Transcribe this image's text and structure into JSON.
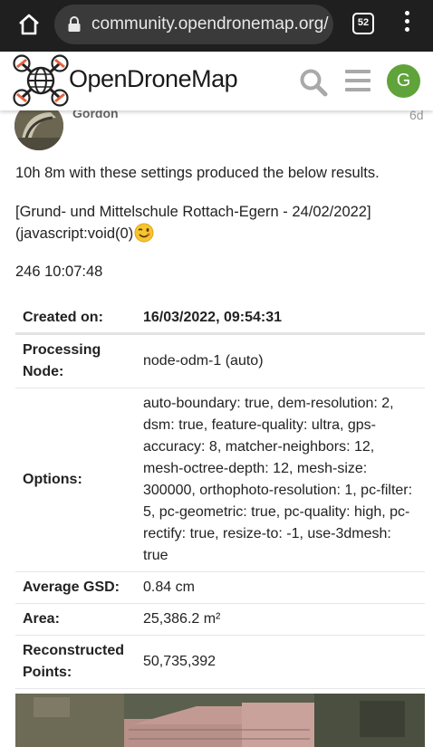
{
  "browser": {
    "url": "community.opendronemap.org/",
    "tab_count": "52"
  },
  "site": {
    "brand": "OpenDroneMap",
    "user_initial": "G"
  },
  "post": {
    "username": "Gordon",
    "age": "6d",
    "paragraph1": "10h 8m with these settings produced the below results.",
    "link_text": "[Grund- und Mittelschule Rottach-Egern - 24/02/2022]",
    "link_href_text": "(javascript:void(0)",
    "emoji": "😉",
    "task_line": "246 10:07:48"
  },
  "table": {
    "header": {
      "key": "Created on:",
      "value": "16/03/2022, 09:54:31"
    },
    "rows": [
      {
        "key": "Processing Node:",
        "value": "node-odm-1 (auto)"
      },
      {
        "key": "Options:",
        "value": "auto-boundary: true, dem-resolution: 2, dsm: true, feature-quality: ultra, gps-accuracy: 8, matcher-neighbors: 12, mesh-octree-depth: 12, mesh-size: 300000, orthophoto-resolution: 1, pc-filter: 5, pc-geometric: true, pc-quality: high, pc-rectify: true, resize-to: -1, use-3dmesh: true"
      },
      {
        "key": "Average GSD:",
        "value": "0.84 cm"
      },
      {
        "key": "Area:",
        "value": "25,386.2 m²"
      },
      {
        "key": "Reconstructed Points:",
        "value": "50,735,392"
      }
    ]
  },
  "colors": {
    "chrome_bg": "#1f1f1f",
    "urlbar_bg": "#3a3a3a",
    "avatar_green": "#5fa33a",
    "drone_orange": "#e8603c"
  },
  "icons": [
    "home-icon",
    "lock-icon",
    "tabs-counter-icon",
    "overflow-menu-icon",
    "opendronemap-logo",
    "search-icon",
    "hamburger-icon"
  ]
}
